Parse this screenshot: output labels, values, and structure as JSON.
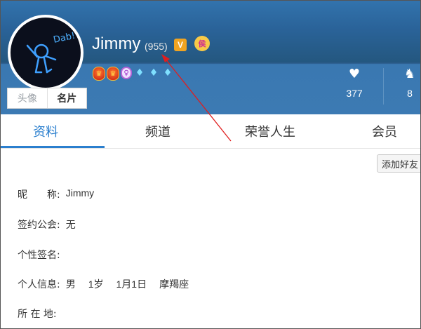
{
  "profile": {
    "username": "Jimmy",
    "level": "(955)",
    "v_badge": "V",
    "crown_badge": "侯",
    "avatar_text": "Dab!"
  },
  "avatar_tabs": [
    {
      "label": "头像",
      "active": false
    },
    {
      "label": "名片",
      "active": true
    }
  ],
  "badges": [
    {
      "type": "red",
      "glyph": "♛"
    },
    {
      "type": "red",
      "glyph": "♛"
    },
    {
      "type": "purple",
      "glyph": "♀"
    },
    {
      "type": "diamond",
      "glyph": "♦"
    },
    {
      "type": "diamond",
      "glyph": "♦"
    },
    {
      "type": "diamond",
      "glyph": "♦"
    }
  ],
  "stats": [
    {
      "icon": "heart-icon",
      "glyph": "♥",
      "value": "377"
    },
    {
      "icon": "ribbon-icon",
      "glyph": "♞",
      "value": "8"
    }
  ],
  "tabs": [
    {
      "label": "资料",
      "active": true
    },
    {
      "label": "频道",
      "active": false
    },
    {
      "label": "荣誉人生",
      "active": false
    },
    {
      "label": "会员",
      "active": false
    }
  ],
  "add_friend_label": "添加好友",
  "info": {
    "nickname_label": "昵　　称:",
    "nickname_value": "Jimmy",
    "guild_label": "签约公会:",
    "guild_value": "无",
    "signature_label": "个性签名:",
    "signature_value": "",
    "personal_label": "个人信息:",
    "gender": "男",
    "age": "1岁",
    "birthday": "1月1日",
    "zodiac": "摩羯座",
    "location_label": "所 在 地:",
    "location_value": ""
  },
  "colors": {
    "header_blue": "#2f6fa9",
    "accent_blue": "#2b7fce",
    "arrow_red": "#e01e1e"
  }
}
